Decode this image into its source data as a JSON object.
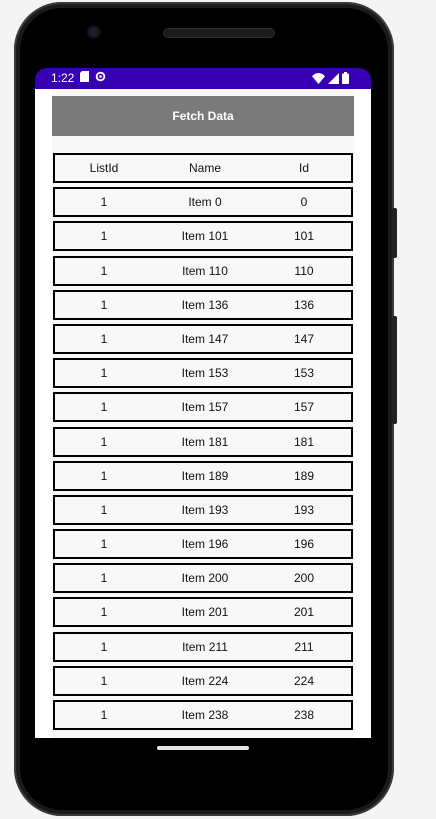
{
  "status_bar": {
    "time": "1:22"
  },
  "app": {
    "title": "Fetch Data"
  },
  "table": {
    "headers": [
      "ListId",
      "Name",
      "Id"
    ],
    "rows": [
      [
        "1",
        "Item 0",
        "0"
      ],
      [
        "1",
        "Item 101",
        "101"
      ],
      [
        "1",
        "Item 110",
        "110"
      ],
      [
        "1",
        "Item 136",
        "136"
      ],
      [
        "1",
        "Item 147",
        "147"
      ],
      [
        "1",
        "Item 153",
        "153"
      ],
      [
        "1",
        "Item 157",
        "157"
      ],
      [
        "1",
        "Item 181",
        "181"
      ],
      [
        "1",
        "Item 189",
        "189"
      ],
      [
        "1",
        "Item 193",
        "193"
      ],
      [
        "1",
        "Item 196",
        "196"
      ],
      [
        "1",
        "Item 200",
        "200"
      ],
      [
        "1",
        "Item 201",
        "201"
      ],
      [
        "1",
        "Item 211",
        "211"
      ],
      [
        "1",
        "Item 224",
        "224"
      ],
      [
        "1",
        "Item 238",
        "238"
      ]
    ]
  },
  "colors": {
    "status_bar": "#3700b3",
    "header_bg": "#7a7a7a",
    "row_border": "#000000"
  }
}
